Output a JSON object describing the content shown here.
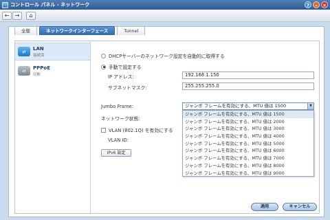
{
  "window": {
    "title": "コントロール パネル - ネットワーク",
    "help_glyph": "?",
    "minimize_glyph": "–",
    "close_glyph": "×"
  },
  "nav": {
    "back_glyph": "←",
    "forward_glyph": "→",
    "home_glyph": "⌂"
  },
  "tabs": [
    {
      "label": "全般"
    },
    {
      "label": "ネットワークインターフェース"
    },
    {
      "label": "Tunnel"
    }
  ],
  "sidebar": {
    "items": [
      {
        "label": "LAN",
        "status": "接続済",
        "icon": "lan-icon"
      },
      {
        "label": "PPPoE",
        "status": "切断",
        "icon": "pppoe-icon"
      }
    ]
  },
  "form": {
    "dhcp_label": "DHCPサーバーのネットワーク設定を自動的に取得する",
    "manual_label": "手動で設定する",
    "ip_label": "IP アドレス:",
    "ip_value": "192.168.1.150",
    "subnet_label": "サブネットマスク:",
    "subnet_value": "255.255.255.0",
    "jumbo_label": "Jumbo Frame:",
    "jumbo_selected": "ジャンボ フレームを有効にする、MTU 値は 1500",
    "network_status_label": "ネットワーク状態:",
    "vlan_label": "VLAN (802.1Q) を有効にする",
    "vlan_id_label": "VLAN ID:",
    "ipv6_button": "IPv6 設定"
  },
  "jumbo_options": [
    "ジャンボ フレームを有効にする、MTU 値は 1500",
    "ジャンボ フレームを有効にする、MTU 値は 2000",
    "ジャンボ フレームを有効にする、MTU 値は 3000",
    "ジャンボ フレームを有効にする、MTU 値は 4000",
    "ジャンボ フレームを有効にする、MTU 値は 5000",
    "ジャンボ フレームを有効にする、MTU 値は 6000",
    "ジャンボ フレームを有効にする、MTU 値は 7000",
    "ジャンボ フレームを有効にする、MTU 値は 8000",
    "ジャンボ フレームを有効にする、MTU 値は 9000"
  ],
  "footer": {
    "apply_label": "適用",
    "cancel_label": "キャンセル"
  },
  "colors": {
    "titlebar": "#2e5d95",
    "active_tab": "#2f6aaa",
    "sidebar_selected": "#dbe9f8",
    "background": "#c9dced"
  }
}
